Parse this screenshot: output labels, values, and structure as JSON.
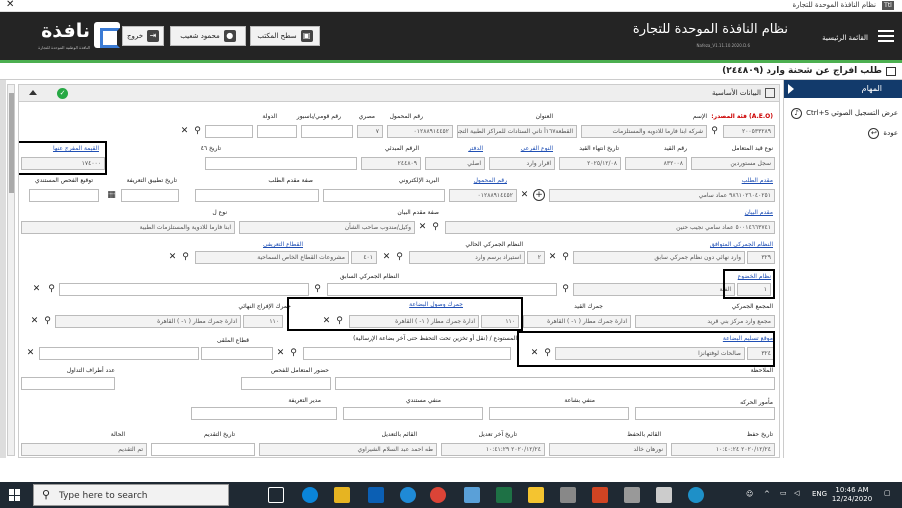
{
  "window": {
    "title": "نظام النافذة الموحدة للتجارة",
    "app_icon": "Ttl",
    "close": "✕"
  },
  "header": {
    "logo_text": "نافذة",
    "logo_subtitle": "النافذة الوطنية الموحدة للتجارة",
    "system_title": "نظام النافذة الموحدة للتجارة",
    "version": "Nafeza_V1.11.10.2020.D.6",
    "home_label": "القائمة الرئيسية",
    "logout_label": "خروج",
    "user_name": "محمود شعيب",
    "desktop_label": "سطح المكتب"
  },
  "page": {
    "title": "طلب افراج عن شحنة وارد (٢٤٤٨٠٩)"
  },
  "section": {
    "title": "البيانات الأساسية"
  },
  "form": {
    "aeo_label": "(A.E.O) فئة المصدر:",
    "name_label": "الإسم",
    "name_value": "شركه ابنا فارما للادويه والمستلزمات",
    "code_value": "٢٠٠٥٣٣٢٨٩",
    "address_label": "العنوان",
    "address_value": "القطعة١٦٧أ تاني الستادات للمراكز الطبية التجمع الخامس",
    "phone_label": "رقم المحمول",
    "phone_value": "٠١٢٨٨٩١٤٤٥٢",
    "egyptian_label": "مصري",
    "id_label": "رقم قومي/باسبور",
    "country_label": "الدولة",
    "country_value": "٧",
    "entry_type_label": "نوع قيد المتعامل",
    "entry_type_value": "سجل مستوردين",
    "entry_no_label": "رقم القيد",
    "entry_no_value": "٨٣٢٠٠٨",
    "entry_end_label": "تاريخ انتهاء القيد",
    "entry_end_value": "٢٠٢٥/١٢/٠٨",
    "subtype_label": "النوع الفرعي",
    "subtype_value": "اقرار وارد",
    "register_label": "الدفتر",
    "register_value": "اصلي",
    "serial_label": "الرقم المبدئي",
    "serial_value": "٢٤٤٨٠٩",
    "date_label": "تاريخ ٤٦",
    "release_value_label": "القيمة المفرج عنها",
    "release_value": "١٧٤٠٠٠",
    "applicant_label": "مقدم الطلب",
    "applicant_value": "٩٨٦١٠٢٦٠٤٠٢٥١ عماد سامي",
    "mobile_label": "رقم المحمول",
    "mobile_value": "٠١٢٨٨٩١٤٤٥٢",
    "email_label": "البريد الإلكتروني",
    "applicant_capacity_label": "صفة مقدم الطلب",
    "apply_date_label": "تاريخ تطبيق التعريفة",
    "direct_inspection_label": "توقيع الفحص المستندي",
    "declarant_label": "مقدم البيان",
    "declarant_value": "٥٠٠١٤٦٦٣٧٤١ عماد سامي نجيب حنين",
    "declarant_capacity_label": "صفة مقدم البيان",
    "declarant_capacity_value": "وكيل/مندوب صاحب الشأن",
    "kind_label": "نوع ل",
    "company_value": "ابنا فارما للادوية والمستلزمات الطبية",
    "customs_system_label": "النظام الجمركي المتوافق",
    "customs_system_value": "وارد نهائي دون نظام جمركي سابق",
    "customs_system_code": "٣٢٩",
    "current_system_label": "النظام الجمركي الحالي",
    "current_system_value": "استيراد برسم وارد",
    "current_system_code": "٢",
    "sector_label": "القطاع التعريفي",
    "sector_value": "مشروعات القطاع الخاص السماحية",
    "sector_code": "٤٠١",
    "subject_label": "نظام الخضوع",
    "subject_value": "الفئة",
    "subject_code": "١",
    "prev_system_label": "النظام الجمركي السابق",
    "customs_complex_label": "المجمع الجمركي",
    "customs_complex_value": "مجمع وارد مركز بني قريد",
    "registry_customs_label": "جمرك القيد",
    "registry_customs_value": "ادارة جمرك مطار ( ١- ) القاهرة",
    "arrival_customs_label": "جمرك وصول البضاعة",
    "arrival_customs_value": "ادارة جمرك مطار ( ١- ) القاهرة",
    "arrival_customs_code": "١١٠",
    "final_release_label": "جمرك الإفراج النهائي",
    "final_release_value": "ادارة جمرك مطار ( ١- ) القاهرة",
    "final_release_code": "١١٠",
    "delivery_place_label": "موقع تسليم البضاعة",
    "delivery_place_value": "صالحات لوفتهانزا",
    "delivery_place_code": "٣٢٤",
    "warehouse_label": "المستودع / (نقل أو تخزين تحت التحفظ حتى آخر بضاعة الإرسالية)",
    "entity_label": "الجهة",
    "port_label": "قطاع الملقى",
    "notes_label": "الملاحظة",
    "attend_label": "حضور المتعامل للفحص",
    "share_label": "عدد أطراف التداول",
    "inspector_label": "مأمور الحركه",
    "shift_label": "منفي بشاعة",
    "doc_inspector_label": "منفي مستندي",
    "tariff_manager_label": "مدير التعريفة",
    "save_date_label": "تاريخ حفظ",
    "save_date_value": "٢٠٢٠/١٢/٢٤ ١٠:٤٠:٢٤",
    "saver_label": "القائم بالحفظ",
    "saver_value": "نورهان خالد",
    "last_edit_label": "تاريخ آخر تعديل",
    "last_edit_value": "٢٠٢٠/١٢/٢٤ ١٠:٤١:٢٩",
    "editor_label": "القائم بالتعديل",
    "editor_value": "طه احمد عبد السلام الشيراوي",
    "submit_date_label": "تاريخ التقديم",
    "status_label": "الحالة",
    "status_value": "تم التقديم"
  },
  "sidebar": {
    "title": "المهام",
    "item1": "عرض التسجيل الصوتي Ctrl+S",
    "item2": "عودة"
  },
  "taskbar": {
    "search_placeholder": "Type here to search",
    "lang": "ENG",
    "time": "10:46 AM",
    "date": "12/24/2020"
  },
  "colors": {
    "header": "#242424",
    "accent_green": "#4caf50",
    "sidebar_head": "#123a6b",
    "link_blue": "#1f4fb4"
  }
}
